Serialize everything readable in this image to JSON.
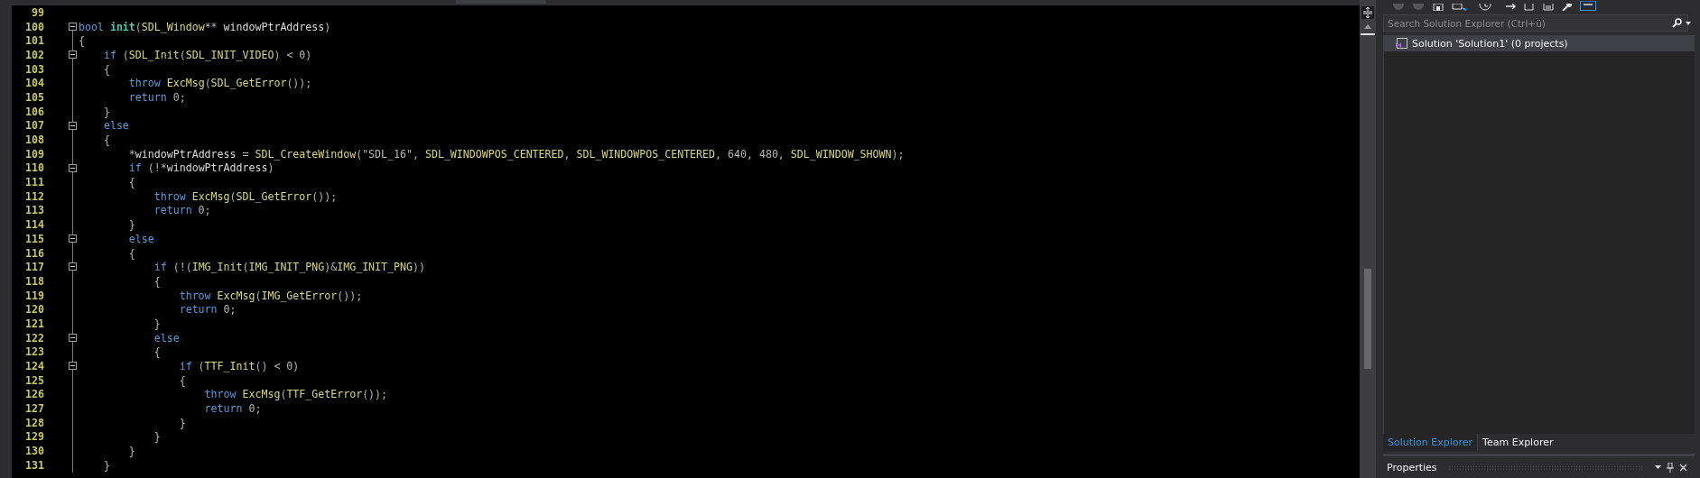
{
  "editor": {
    "lines": [
      {
        "number": "99",
        "fold": false
      },
      {
        "number": "100",
        "fold": true,
        "tokens": [
          {
            "kind": "keyword",
            "text": "bool"
          },
          {
            "kind": "definition",
            "text": " init"
          },
          {
            "kind": "plain",
            "text": "("
          },
          {
            "kind": "ident",
            "text": "SDL_Window"
          },
          {
            "kind": "plain",
            "text": "**"
          },
          {
            "kind": "param",
            "text": " windowPtrAddress"
          },
          {
            "kind": "plain",
            "text": ")"
          }
        ]
      },
      {
        "number": "101",
        "fold": false,
        "tokens": [
          {
            "kind": "plain",
            "text": "{"
          }
        ]
      },
      {
        "number": "102",
        "fold": true,
        "tokens": [
          {
            "kind": "keyword",
            "text": "    if"
          },
          {
            "kind": "plain",
            "text": " ("
          },
          {
            "kind": "ident",
            "text": "SDL_Init"
          },
          {
            "kind": "plain",
            "text": "("
          },
          {
            "kind": "ident",
            "text": "SDL_INIT_VIDEO"
          },
          {
            "kind": "plain",
            "text": ") <"
          },
          {
            "kind": "number",
            "text": " 0"
          },
          {
            "kind": "plain",
            "text": ")"
          }
        ]
      },
      {
        "number": "103",
        "fold": false,
        "tokens": [
          {
            "kind": "plain",
            "text": "    {"
          }
        ]
      },
      {
        "number": "104",
        "fold": false,
        "tokens": [
          {
            "kind": "keyword",
            "text": "        throw"
          },
          {
            "kind": "ident",
            "text": " ExcMsg"
          },
          {
            "kind": "plain",
            "text": "("
          },
          {
            "kind": "ident",
            "text": "SDL_GetError"
          },
          {
            "kind": "plain",
            "text": "());"
          }
        ]
      },
      {
        "number": "105",
        "fold": false,
        "tokens": [
          {
            "kind": "keyword",
            "text": "        return"
          },
          {
            "kind": "number",
            "text": " 0"
          },
          {
            "kind": "plain",
            "text": ";"
          }
        ]
      },
      {
        "number": "106",
        "fold": false,
        "tokens": [
          {
            "kind": "plain",
            "text": "    }"
          }
        ]
      },
      {
        "number": "107",
        "fold": true,
        "tokens": [
          {
            "kind": "keyword",
            "text": "    else"
          }
        ]
      },
      {
        "number": "108",
        "fold": false,
        "tokens": [
          {
            "kind": "plain",
            "text": "    {"
          }
        ]
      },
      {
        "number": "109",
        "fold": false,
        "tokens": [
          {
            "kind": "plain",
            "text": "        *"
          },
          {
            "kind": "param",
            "text": "windowPtrAddress"
          },
          {
            "kind": "plain",
            "text": " ="
          },
          {
            "kind": "ident",
            "text": " SDL_CreateWindow"
          },
          {
            "kind": "plain",
            "text": "("
          },
          {
            "kind": "string",
            "text": "\"SDL_16\""
          },
          {
            "kind": "plain",
            "text": ","
          },
          {
            "kind": "ident",
            "text": " SDL_WINDOWPOS_CENTERED"
          },
          {
            "kind": "plain",
            "text": ","
          },
          {
            "kind": "ident",
            "text": " SDL_WINDOWPOS_CENTERED"
          },
          {
            "kind": "plain",
            "text": ","
          },
          {
            "kind": "number",
            "text": " 640"
          },
          {
            "kind": "plain",
            "text": ","
          },
          {
            "kind": "number",
            "text": " 480"
          },
          {
            "kind": "plain",
            "text": ","
          },
          {
            "kind": "ident",
            "text": " SDL_WINDOW_SHOWN"
          },
          {
            "kind": "plain",
            "text": ");"
          }
        ]
      },
      {
        "number": "110",
        "fold": true,
        "tokens": [
          {
            "kind": "keyword",
            "text": "        if"
          },
          {
            "kind": "plain",
            "text": " (!*"
          },
          {
            "kind": "param",
            "text": "windowPtrAddress"
          },
          {
            "kind": "plain",
            "text": ")"
          }
        ]
      },
      {
        "number": "111",
        "fold": false,
        "tokens": [
          {
            "kind": "plain",
            "text": "        {"
          }
        ]
      },
      {
        "number": "112",
        "fold": false,
        "tokens": [
          {
            "kind": "keyword",
            "text": "            throw"
          },
          {
            "kind": "ident",
            "text": " ExcMsg"
          },
          {
            "kind": "plain",
            "text": "("
          },
          {
            "kind": "ident",
            "text": "SDL_GetError"
          },
          {
            "kind": "plain",
            "text": "());"
          }
        ]
      },
      {
        "number": "113",
        "fold": false,
        "tokens": [
          {
            "kind": "keyword",
            "text": "            return"
          },
          {
            "kind": "number",
            "text": " 0"
          },
          {
            "kind": "plain",
            "text": ";"
          }
        ]
      },
      {
        "number": "114",
        "fold": false,
        "tokens": [
          {
            "kind": "plain",
            "text": "        }"
          }
        ]
      },
      {
        "number": "115",
        "fold": true,
        "tokens": [
          {
            "kind": "keyword",
            "text": "        else"
          }
        ]
      },
      {
        "number": "116",
        "fold": false,
        "tokens": [
          {
            "kind": "plain",
            "text": "        {"
          }
        ]
      },
      {
        "number": "117",
        "fold": true,
        "tokens": [
          {
            "kind": "keyword",
            "text": "            if"
          },
          {
            "kind": "plain",
            "text": " (!("
          },
          {
            "kind": "ident",
            "text": "IMG_Init"
          },
          {
            "kind": "plain",
            "text": "("
          },
          {
            "kind": "ident",
            "text": "IMG_INIT_PNG"
          },
          {
            "kind": "plain",
            "text": ")&"
          },
          {
            "kind": "ident",
            "text": "IMG_INIT_PNG"
          },
          {
            "kind": "plain",
            "text": "))"
          }
        ]
      },
      {
        "number": "118",
        "fold": false,
        "tokens": [
          {
            "kind": "plain",
            "text": "            {"
          }
        ]
      },
      {
        "number": "119",
        "fold": false,
        "tokens": [
          {
            "kind": "keyword",
            "text": "                throw"
          },
          {
            "kind": "ident",
            "text": " ExcMsg"
          },
          {
            "kind": "plain",
            "text": "("
          },
          {
            "kind": "ident",
            "text": "IMG_GetError"
          },
          {
            "kind": "plain",
            "text": "());"
          }
        ]
      },
      {
        "number": "120",
        "fold": false,
        "tokens": [
          {
            "kind": "keyword",
            "text": "                return"
          },
          {
            "kind": "number",
            "text": " 0"
          },
          {
            "kind": "plain",
            "text": ";"
          }
        ]
      },
      {
        "number": "121",
        "fold": false,
        "tokens": [
          {
            "kind": "plain",
            "text": "            }"
          }
        ]
      },
      {
        "number": "122",
        "fold": true,
        "tokens": [
          {
            "kind": "keyword",
            "text": "            else"
          }
        ]
      },
      {
        "number": "123",
        "fold": false,
        "tokens": [
          {
            "kind": "plain",
            "text": "            {"
          }
        ]
      },
      {
        "number": "124",
        "fold": true,
        "tokens": [
          {
            "kind": "keyword",
            "text": "                if"
          },
          {
            "kind": "plain",
            "text": " ("
          },
          {
            "kind": "ident",
            "text": "TTF_Init"
          },
          {
            "kind": "plain",
            "text": "() <"
          },
          {
            "kind": "number",
            "text": " 0"
          },
          {
            "kind": "plain",
            "text": ")"
          }
        ]
      },
      {
        "number": "125",
        "fold": false,
        "tokens": [
          {
            "kind": "plain",
            "text": "                {"
          }
        ]
      },
      {
        "number": "126",
        "fold": false,
        "tokens": [
          {
            "kind": "keyword",
            "text": "                    throw"
          },
          {
            "kind": "ident",
            "text": " ExcMsg"
          },
          {
            "kind": "plain",
            "text": "("
          },
          {
            "kind": "ident",
            "text": "TTF_GetError"
          },
          {
            "kind": "plain",
            "text": "());"
          }
        ]
      },
      {
        "number": "127",
        "fold": false,
        "tokens": [
          {
            "kind": "keyword",
            "text": "                    return"
          },
          {
            "kind": "number",
            "text": " 0"
          },
          {
            "kind": "plain",
            "text": ";"
          }
        ]
      },
      {
        "number": "128",
        "fold": false,
        "tokens": [
          {
            "kind": "plain",
            "text": "                }"
          }
        ]
      },
      {
        "number": "129",
        "fold": false,
        "tokens": [
          {
            "kind": "plain",
            "text": "            }"
          }
        ]
      },
      {
        "number": "130",
        "fold": false,
        "tokens": [
          {
            "kind": "plain",
            "text": "        }"
          }
        ]
      },
      {
        "number": "131",
        "fold": false,
        "tokens": [
          {
            "kind": "plain",
            "text": "    }"
          }
        ]
      }
    ]
  },
  "solution_explorer": {
    "search": {
      "placeholder": "Search Solution Explorer (Ctrl+ü)"
    },
    "items": [
      {
        "label": "Solution 'Solution1' (0 projects)",
        "selected": true
      }
    ],
    "tabs": [
      {
        "label": "Solution Explorer",
        "selected": true
      },
      {
        "label": "Team Explorer",
        "selected": false
      }
    ]
  },
  "properties": {
    "title": "Properties"
  }
}
